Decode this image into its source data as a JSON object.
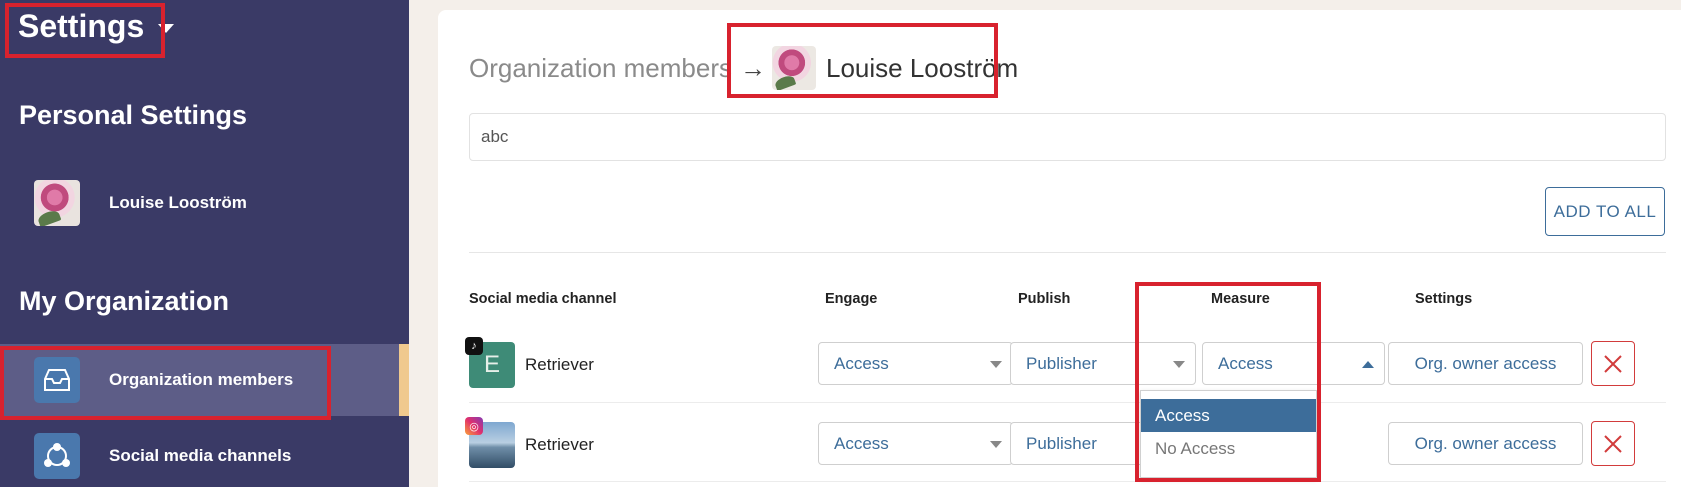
{
  "sidebar": {
    "title": "Settings",
    "personal_heading": "Personal Settings",
    "user_name": "Louise Looström",
    "org_heading": "My Organization",
    "items": [
      {
        "label": "Organization members",
        "icon": "inbox-icon"
      },
      {
        "label": "Social media channels",
        "icon": "share-icon"
      }
    ]
  },
  "main": {
    "breadcrumb": {
      "parent": "Organization members",
      "arrow": "→",
      "current": "Louise Looström"
    },
    "search": {
      "value": "abc"
    },
    "add_to_all_label": "ADD TO ALL",
    "columns": {
      "channel": "Social media channel",
      "engage": "Engage",
      "publish": "Publish",
      "measure": "Measure",
      "settings": "Settings"
    },
    "rows": [
      {
        "network": "tiktok",
        "avatar_letter": "E",
        "name": "Retriever",
        "engage": "Access",
        "publish": "Publisher",
        "measure": "Access",
        "settings": "Org. owner access"
      },
      {
        "network": "instagram",
        "name": "Retriever",
        "engage": "Access",
        "publish": "Publisher",
        "measure": "Access",
        "settings": "Org. owner access"
      }
    ],
    "measure_dropdown": {
      "options": [
        "Access",
        "No Access"
      ],
      "selected": "Access"
    }
  },
  "colors": {
    "sidebar_bg": "#3a3a66",
    "accent_blue": "#3d6d9a",
    "highlight_red": "#d8222e",
    "active_stripe": "#f0c98e",
    "delete_red": "#d23b3b"
  }
}
